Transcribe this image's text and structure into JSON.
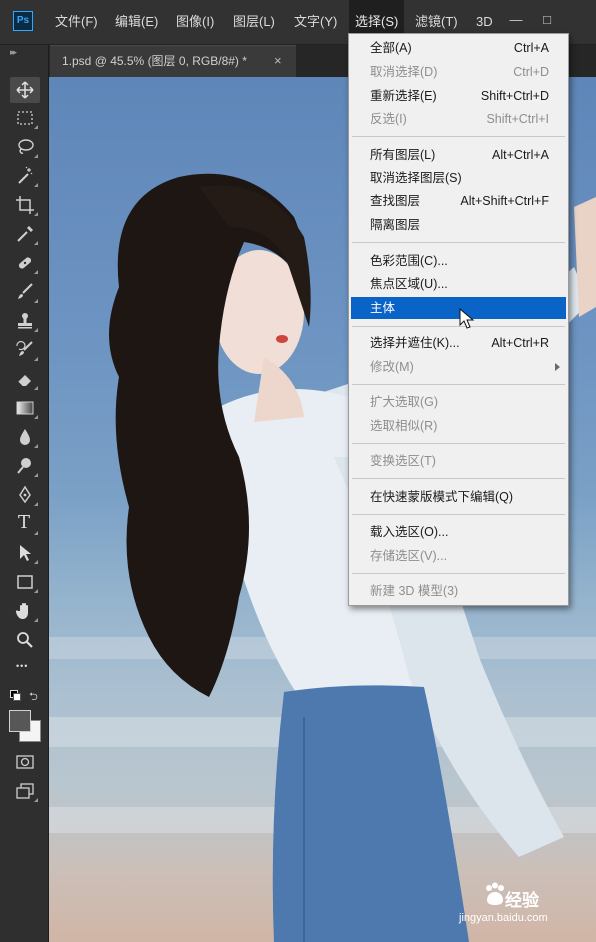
{
  "app": {
    "logo": "Ps"
  },
  "menubar": {
    "items": [
      "文件(F)",
      "编辑(E)",
      "图像(I)",
      "图层(L)",
      "文字(Y)",
      "选择(S)",
      "滤镜(T)",
      "3D"
    ],
    "active_item": "选择(S)"
  },
  "window_controls": {
    "minimize": "—",
    "maximize": "□"
  },
  "document_tab": {
    "title": "1.psd @ 45.5% (图层 0, RGB/8#) *",
    "close": "×"
  },
  "toolbar": {
    "tools": [
      "move-tool",
      "marquee-tool",
      "lasso-tool",
      "magic-wand-tool",
      "crop-tool",
      "eyedropper-tool",
      "healing-brush-tool",
      "brush-tool",
      "clone-stamp-tool",
      "history-brush-tool",
      "eraser-tool",
      "gradient-tool",
      "blur-tool",
      "dodge-tool",
      "pen-tool",
      "type-tool",
      "path-selection-tool",
      "rectangle-tool",
      "hand-tool",
      "zoom-tool",
      "more-tools",
      "swap-colors",
      "foreground-background-colors",
      "quick-mask-mode",
      "screen-mode"
    ],
    "type_tool_glyph": "T",
    "more_glyph": "•••"
  },
  "select_menu": {
    "items": [
      {
        "label": "全部(A)",
        "shortcut": "Ctrl+A",
        "enabled": true
      },
      {
        "label": "取消选择(D)",
        "shortcut": "Ctrl+D",
        "enabled": false
      },
      {
        "label": "重新选择(E)",
        "shortcut": "Shift+Ctrl+D",
        "enabled": true
      },
      {
        "label": "反选(I)",
        "shortcut": "Shift+Ctrl+I",
        "enabled": false
      },
      {
        "label": "所有图层(L)",
        "shortcut": "Alt+Ctrl+A",
        "enabled": true
      },
      {
        "label": "取消选择图层(S)",
        "shortcut": "",
        "enabled": true
      },
      {
        "label": "查找图层",
        "shortcut": "Alt+Shift+Ctrl+F",
        "enabled": true
      },
      {
        "label": "隔离图层",
        "shortcut": "",
        "enabled": true
      },
      {
        "label": "色彩范围(C)...",
        "shortcut": "",
        "enabled": true
      },
      {
        "label": "焦点区域(U)...",
        "shortcut": "",
        "enabled": true
      },
      {
        "label": "主体",
        "shortcut": "",
        "enabled": true,
        "highlighted": true
      },
      {
        "label": "选择并遮住(K)...",
        "shortcut": "Alt+Ctrl+R",
        "enabled": true
      },
      {
        "label": "修改(M)",
        "shortcut": "",
        "enabled": false,
        "submenu": true
      },
      {
        "label": "扩大选取(G)",
        "shortcut": "",
        "enabled": false
      },
      {
        "label": "选取相似(R)",
        "shortcut": "",
        "enabled": false
      },
      {
        "label": "变换选区(T)",
        "shortcut": "",
        "enabled": false
      },
      {
        "label": "在快速蒙版模式下编辑(Q)",
        "shortcut": "",
        "enabled": true
      },
      {
        "label": "载入选区(O)...",
        "shortcut": "",
        "enabled": true
      },
      {
        "label": "存储选区(V)...",
        "shortcut": "",
        "enabled": false
      },
      {
        "label": "新建 3D 模型(3)",
        "shortcut": "",
        "enabled": false
      }
    ]
  },
  "watermark": {
    "brand": "经验",
    "url": "jingyan.baidu.com"
  },
  "colors": {
    "menubar_bg": "#323232",
    "menu_highlight": "#0a64c8",
    "menu_bg": "#f0f0f0",
    "disabled_text": "#8e8e8e"
  }
}
